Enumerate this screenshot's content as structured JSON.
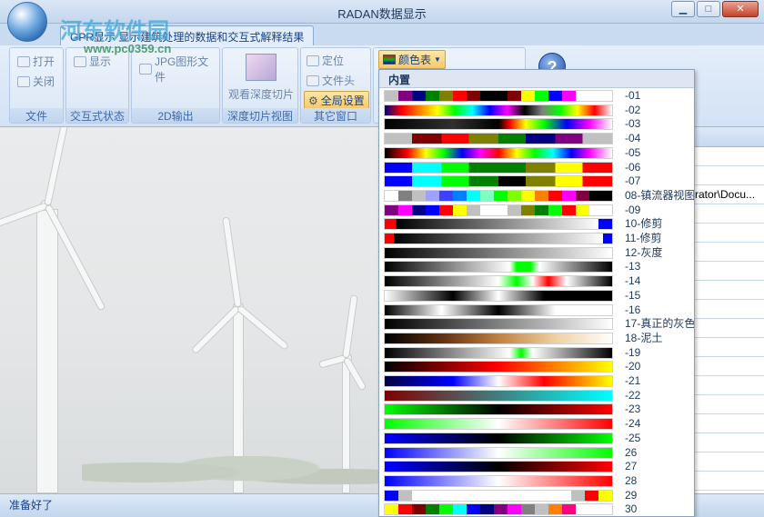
{
  "window": {
    "title": "RADAN数据显示",
    "minimize": "▁",
    "maximize": "□",
    "close": "✕"
  },
  "watermark": {
    "logo_text": "河东软件园",
    "url": "www.pc0359.cn"
  },
  "ribbon": {
    "tab_label": "GPR显示 显示建筑处理的数据和交互式解释结果",
    "groups": [
      {
        "label": "文件",
        "items": [
          "打开",
          "关闭"
        ]
      },
      {
        "label": "交互式状态",
        "items": [
          "显示"
        ]
      },
      {
        "label": "2D输出",
        "items": [
          "JPG图形文件"
        ]
      },
      {
        "label": "深度切片视图",
        "items": [
          "观看深度切片"
        ]
      },
      {
        "label": "其它窗口",
        "items": [
          "定位",
          "文件头",
          "全局设置"
        ]
      }
    ],
    "color_table_button": "颜色表",
    "help_glyph": "?"
  },
  "right_panel": {
    "rows": [
      "",
      "",
      "rator\\Docu...",
      "",
      "",
      "",
      "",
      "",
      "",
      "",
      "",
      "",
      "",
      "",
      "",
      "",
      "",
      ""
    ]
  },
  "status": {
    "text": "准备好了"
  },
  "colortable": {
    "section_title": "内置",
    "maps": [
      {
        "label": "-01",
        "gradient": "linear-gradient(90deg,#c0c0c0 0 6%,#800080 6% 12%,#000080 12% 18%,#008000 18% 24%,#808000 24% 30%,#ff0000 30% 36%,#800000 36% 42%,#000000 42% 54%,#800000 54% 60%,#ffff00 60% 66%,#00ff00 66% 72%,#0000ff 72% 78%,#ff00ff 78% 84%,#ffffff 84%)"
      },
      {
        "label": "-02",
        "gradient": "linear-gradient(90deg,#000080,#ff0000,#ff8000,#ffff00,#00ff00,#00ffff,#0000ff,#ff00ff,#000000,#808080,#00ff00,#ffff00,#ff0000,#ffffff)"
      },
      {
        "label": "-03",
        "gradient": "linear-gradient(90deg,#000000,#303030 30%,#000000 50%,#ff0000 55%,#ffff00 62%,#00ff00 70%,#0000ff 80%,#ff00ff 90%,#ffffff)"
      },
      {
        "label": "-04",
        "gradient": "linear-gradient(90deg,#c0c0c0 0 12%,#800000 12% 25%,#ff0000 25% 37%,#808000 37% 50%,#008000 50% 62%,#000080 62% 75%,#800080 75% 87%,#c0c0c0 87%)"
      },
      {
        "label": "-05",
        "gradient": "linear-gradient(90deg,#000000,#ff0000 10%,#ffff00 18%,#00ff00 26%,#0000ff 34%,#ff00ff 42%,#ff0000 50%,#ffff00 58%,#00ff00 66%,#00ffff 74%,#0000ff 82%,#ff00ff 90%,#ffffff)"
      },
      {
        "label": "-06",
        "gradient": "linear-gradient(90deg,#0000ff 0 12%,#00ffff 12% 25%,#00ff00 25% 37%,#008000 37% 62%,#808000 62% 75%,#ffff00 75% 87%,#ff0000 87%)"
      },
      {
        "label": "-07",
        "gradient": "linear-gradient(90deg,#0000ff 0 12%,#00ffff 12% 25%,#00ff00 25% 37%,#008000 37% 50%,#000000 50% 62%,#808000 62% 75%,#ffff00 75% 87%,#ff0000 87%)"
      },
      {
        "label": "08-镇流器视图",
        "gradient": "linear-gradient(90deg,#ffffff 0 6%,#808080 6% 12%,#c0c0c0 12% 18%,#a0a0ff 18% 24%,#4040ff 24% 30%,#0080ff 30% 36%,#00ffff 36% 42%,#80ffc0 42% 48%,#00ff00 48% 54%,#80ff00 54% 60%,#ffff00 60% 66%,#ff8000 66% 72%,#ff0000 72% 78%,#ff00ff 78% 84%,#800040 84% 90%,#000000 90%)"
      },
      {
        "label": "-09",
        "gradient": "linear-gradient(90deg,#800080 0 6%,#ff00ff 6% 12%,#000080 12% 18%,#0000ff 18% 24%,#ff0000 24% 30%,#ffff00 30% 36%,#c0c0c0 36% 42%,#ffffff 42% 54%,#c0c0c0 54% 60%,#808000 60% 66%,#008000 66% 72%,#00ff00 72% 78%,#ff0000 78% 84%,#ffff00 84% 90%,#ffffff 90%)"
      },
      {
        "label": "10-修剪",
        "gradient": "linear-gradient(90deg,#ff0000 0 5%,#000000 5%,#ffffff 94%,#0000ff 94%)"
      },
      {
        "label": "11-修剪",
        "gradient": "linear-gradient(90deg,#ff0000 0 4%,#000000 4%,#ffffff 96%,#0000ff 96%)"
      },
      {
        "label": "12-灰度",
        "gradient": "linear-gradient(90deg,#000000,#ffffff)"
      },
      {
        "label": "-13",
        "gradient": "linear-gradient(90deg,#000000,#ffffff 55%,#00ff00 58%,#00ff00 64%,#ffffff 68%,#000000)"
      },
      {
        "label": "-14",
        "gradient": "linear-gradient(90deg,#000000,#ffffff 50%,#00ff00 58%,#ffffff 65%,#ff0000 72%,#ffffff 80%,#000000)"
      },
      {
        "label": "-15",
        "gradient": "linear-gradient(90deg,#ffffff,#000000 30%,#ffffff 50%,#000000 70%,#000000)"
      },
      {
        "label": "-16",
        "gradient": "linear-gradient(90deg,#000000,#ffffff 25%,#000000 50%,#ffffff 75%,#ffffff)"
      },
      {
        "label": "17-真正的灰色",
        "gradient": "linear-gradient(90deg,#000000,#808080 50%,#ffffff)"
      },
      {
        "label": "18-泥土",
        "gradient": "linear-gradient(90deg,#000000,#603010 25%,#c08040 50%,#f0d0a0 75%,#ffffff)"
      },
      {
        "label": "-19",
        "gradient": "linear-gradient(90deg,#000000,#ffffff 55%,#00ff00 60%,#ffffff 65%,#000000)"
      },
      {
        "label": "-20",
        "gradient": "linear-gradient(90deg,#000000,#800000 25%,#ff0000 50%,#ff8000 75%,#ffff00)"
      },
      {
        "label": "-21",
        "gradient": "linear-gradient(90deg,#000040,#0000ff 30%,#ffffff 50%,#ff0000 70%,#ff8000 85%,#ffff00)"
      },
      {
        "label": "-22",
        "gradient": "linear-gradient(90deg,#800000,#00ffff)"
      },
      {
        "label": "-23",
        "gradient": "linear-gradient(90deg,#00ff00,#000000 50%,#ff0000)"
      },
      {
        "label": "-24",
        "gradient": "linear-gradient(90deg,#00ff00,#ffffff 50%,#ff0000)"
      },
      {
        "label": "-25",
        "gradient": "linear-gradient(90deg,#0000ff,#000000 50%,#00ff00)"
      },
      {
        "label": "26",
        "gradient": "linear-gradient(90deg,#0000ff,#ffffff 50%,#00ff00)"
      },
      {
        "label": "27",
        "gradient": "linear-gradient(90deg,#0000ff,#000000 50%,#ff0000)"
      },
      {
        "label": "28",
        "gradient": "linear-gradient(90deg,#0000ff,#ffffff 50%,#ff0000)"
      },
      {
        "label": "29",
        "gradient": "linear-gradient(90deg,#0000ff 0 6%,#c0c0c0 6% 12%,#ffffff 12% 82%,#c0c0c0 82% 88%,#ff0000 88% 94%,#ffff00 94%)"
      },
      {
        "label": "30",
        "gradient": "linear-gradient(90deg,#ffff00 0 6%,#ff0000 6% 12%,#800000 12% 18%,#008000 18% 24%,#00ff00 24% 30%,#00ffff 30% 36%,#0000ff 36% 42%,#000080 42% 48%,#800080 48% 54%,#ff00ff 54% 60%,#808080 60% 66%,#c0c0c0 66% 72%,#ff8000 72% 78%,#ff0080 78% 84%,#ffffff 84%)"
      }
    ]
  }
}
